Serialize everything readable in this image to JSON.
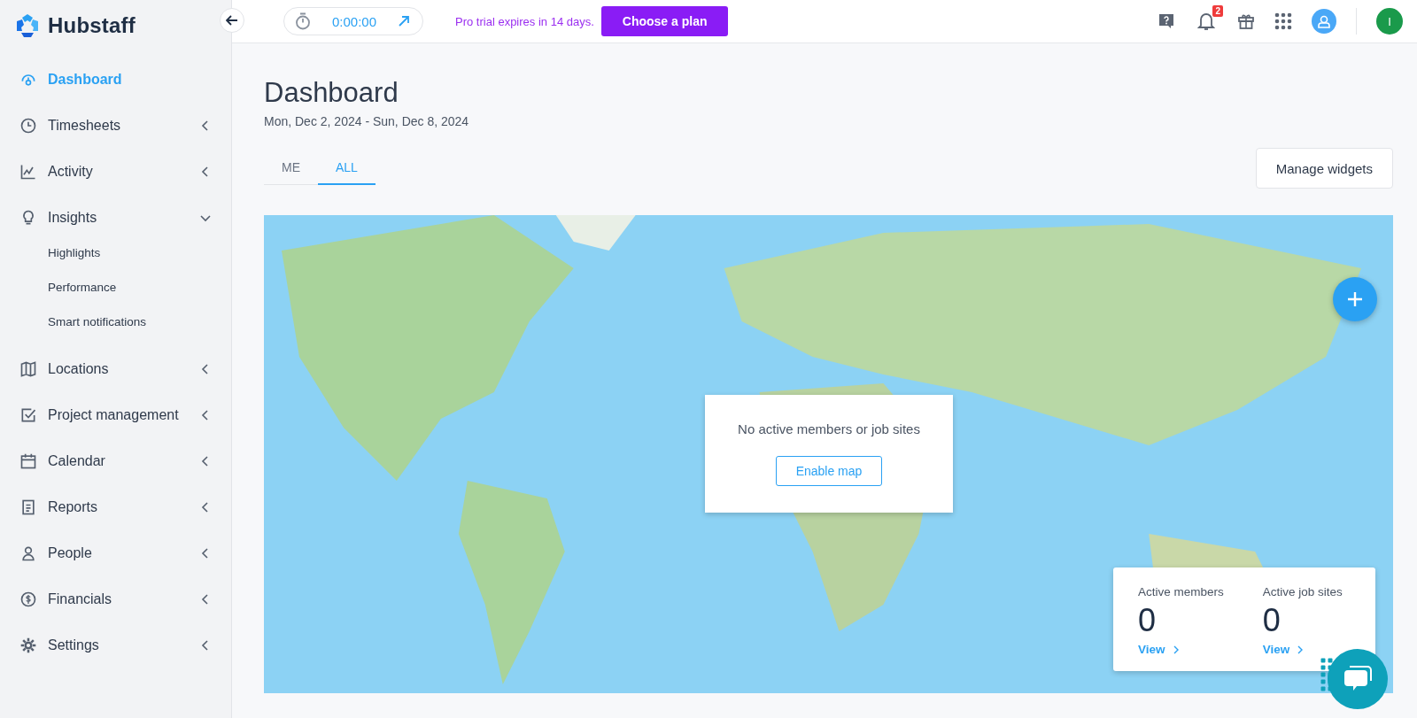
{
  "brand": {
    "name": "Hubstaff"
  },
  "sidebar": {
    "items": [
      {
        "label": "Dashboard",
        "selected": true
      },
      {
        "label": "Timesheets",
        "selected": false,
        "expanded": false
      },
      {
        "label": "Activity",
        "selected": false,
        "expanded": false
      },
      {
        "label": "Insights",
        "selected": false,
        "expanded": true,
        "children": [
          {
            "label": "Highlights",
            "selected": false
          },
          {
            "label": "Performance",
            "selected": false
          },
          {
            "label": "Smart notifications",
            "selected": false
          }
        ]
      },
      {
        "label": "Locations",
        "selected": false,
        "expanded": false
      },
      {
        "label": "Project management",
        "selected": false,
        "expanded": false
      },
      {
        "label": "Calendar",
        "selected": false,
        "expanded": false
      },
      {
        "label": "Reports",
        "selected": false,
        "expanded": false
      },
      {
        "label": "People",
        "selected": false,
        "expanded": false
      },
      {
        "label": "Financials",
        "selected": false,
        "expanded": false
      },
      {
        "label": "Settings",
        "selected": false,
        "expanded": false
      }
    ]
  },
  "topbar": {
    "timer": "0:00:00",
    "trial_text": "Pro trial expires in 14 days.",
    "plan_button": "Choose a plan",
    "notification_count": "2",
    "user_initial": "I"
  },
  "page": {
    "title": "Dashboard",
    "date_range": "Mon, Dec 2, 2024 - Sun, Dec 8, 2024",
    "manage_button": "Manage widgets"
  },
  "tabs": [
    {
      "label": "ME",
      "selected": false
    },
    {
      "label": "ALL",
      "selected": true
    }
  ],
  "map": {
    "empty_message": "No active members or job sites",
    "enable_button": "Enable map",
    "stats": [
      {
        "label": "Active members",
        "value": "0",
        "link": "View"
      },
      {
        "label": "Active job sites",
        "value": "0",
        "link": "View"
      }
    ]
  }
}
